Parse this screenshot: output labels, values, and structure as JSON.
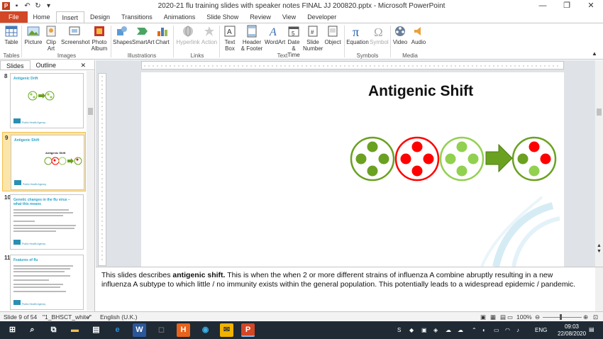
{
  "window": {
    "title": "2020-21 flu training slides with speaker notes FINAL JJ 200820.pptx - Microsoft PowerPoint",
    "app_icon_letter": "P",
    "controls": [
      "—",
      "❐",
      "✕"
    ]
  },
  "tabs": [
    {
      "label": "File"
    },
    {
      "label": "Home"
    },
    {
      "label": "Insert"
    },
    {
      "label": "Design"
    },
    {
      "label": "Transitions"
    },
    {
      "label": "Animations"
    },
    {
      "label": "Slide Show"
    },
    {
      "label": "Review"
    },
    {
      "label": "View"
    },
    {
      "label": "Developer"
    }
  ],
  "ribbon": {
    "groups": {
      "tables": "Tables",
      "images": "Images",
      "illustrations": "Illustrations",
      "links": "Links",
      "text": "Text",
      "symbols": "Symbols",
      "media": "Media"
    },
    "buttons": {
      "table": "Table",
      "picture": "Picture",
      "clipart_1": "Clip",
      "clipart_2": "Art",
      "screenshot": "Screenshot",
      "album_1": "Photo",
      "album_2": "Album",
      "shapes": "Shapes",
      "smartart": "SmartArt",
      "chart": "Chart",
      "hyperlink": "Hyperlink",
      "action": "Action",
      "textbox_1": "Text",
      "textbox_2": "Box",
      "header_1": "Header",
      "header_2": "& Footer",
      "wordart": "WordArt",
      "datetime_1": "Date",
      "datetime_2": "& Time",
      "slidenum_1": "Slide",
      "slidenum_2": "Number",
      "object": "Object",
      "equation": "Equation",
      "symbol": "Symbol",
      "video": "Video",
      "audio": "Audio"
    }
  },
  "panel": {
    "tabs": [
      "Slides",
      "Outline"
    ],
    "close": "✕",
    "thumbnails": [
      {
        "num": "8",
        "title": "Antigenic Drift",
        "logo": "Public Health Agency"
      },
      {
        "num": "9",
        "title": "Antigenic Shift",
        "center": "Antigenic Shift",
        "logo": "Public Health Agency"
      },
      {
        "num": "10",
        "title": "Genetic changes in the flu virus – what this means",
        "logo": "Public Health Agency"
      },
      {
        "num": "11",
        "title": "Features of flu",
        "logo": "Public Health Agency"
      }
    ]
  },
  "slide": {
    "title": "Antigenic Shift"
  },
  "notes": {
    "prefix": "This slides describes ",
    "bold": "antigenic shift.",
    "rest": " This is when the when 2 or more different strains of influenza A combine abruptly resulting in a new influenza A subtype to which little / no immunity exists within the general population. This potentially leads to a widespread epidemic / pandemic."
  },
  "status": {
    "slide": "Slide 9 of 54",
    "theme": "\"1_BHSCT_white\"",
    "language": "English (U.K.)",
    "zoom": "100%"
  },
  "taskbar": {
    "lang": "ENG",
    "time": "09:03",
    "date": "22/08/2020"
  },
  "colors": {
    "green": "#6aa121",
    "light_green": "#92d050",
    "red": "#ff0000",
    "file_tab": "#d24726"
  }
}
